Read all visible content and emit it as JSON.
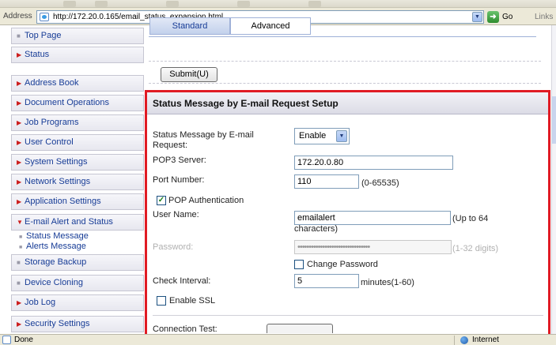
{
  "browser": {
    "address_label": "Address",
    "url": "http://172.20.0.165/email_status_expansion.html",
    "go_label": "Go",
    "links_label": "Links",
    "status_text": "Done",
    "zone_label": "Internet"
  },
  "sidebar": {
    "items": [
      {
        "label": "Top Page",
        "marker": "square"
      },
      {
        "label": "Status",
        "marker": "arrow"
      },
      {
        "label": "Address Book",
        "marker": "arrow"
      },
      {
        "label": "Document Operations",
        "marker": "arrow"
      },
      {
        "label": "Job Programs",
        "marker": "arrow"
      },
      {
        "label": "User Control",
        "marker": "arrow"
      },
      {
        "label": "System Settings",
        "marker": "arrow"
      },
      {
        "label": "Network Settings",
        "marker": "arrow"
      },
      {
        "label": "Application Settings",
        "marker": "arrow"
      },
      {
        "label": "E-mail Alert and Status",
        "marker": "arrow-down"
      },
      {
        "label": "Storage Backup",
        "marker": "square"
      },
      {
        "label": "Device Cloning",
        "marker": "square"
      },
      {
        "label": "Job Log",
        "marker": "arrow"
      },
      {
        "label": "Security Settings",
        "marker": "arrow"
      }
    ],
    "subitems": [
      {
        "label": "Status Message"
      },
      {
        "label": "Alerts Message"
      }
    ]
  },
  "tabs": {
    "standard": "Standard",
    "advanced": "Advanced"
  },
  "submit_label": "Submit(U)",
  "form": {
    "title": "Status Message by E-mail Request Setup",
    "status_message_label": "Status Message by E-mail Request:",
    "status_message_value": "Enable",
    "pop3_server_label": "POP3 Server:",
    "pop3_server_value": "172.20.0.80",
    "port_number_label": "Port Number:",
    "port_number_value": "110",
    "port_number_hint": "(0-65535)",
    "pop_auth_label": "POP Authentication",
    "pop_auth_checked": true,
    "user_name_label": "User Name:",
    "user_name_value": "emailalert",
    "user_name_hint": "(Up to 64 characters)",
    "password_label": "Password:",
    "password_value": "••••••••••••••••••••••••••••••••",
    "password_hint": "(1-32 digits)",
    "change_password_label": "Change Password",
    "change_password_checked": false,
    "check_interval_label": "Check Interval:",
    "check_interval_value": "5",
    "check_interval_hint": "minutes(1-60)",
    "enable_ssl_label": "Enable SSL",
    "enable_ssl_checked": false,
    "connection_test_label": "Connection Test:"
  },
  "colors": {
    "highlight_border": "#e01b24",
    "nav_text": "#173c96",
    "nav_arrow": "#cc1e1e"
  }
}
